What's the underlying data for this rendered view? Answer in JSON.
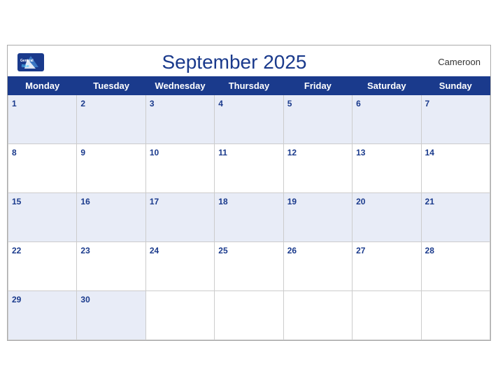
{
  "header": {
    "title": "September 2025",
    "country": "Cameroon",
    "logo_line1": "General",
    "logo_line2": "Blue"
  },
  "days": [
    "Monday",
    "Tuesday",
    "Wednesday",
    "Thursday",
    "Friday",
    "Saturday",
    "Sunday"
  ],
  "weeks": [
    [
      {
        "num": "1"
      },
      {
        "num": "2"
      },
      {
        "num": "3"
      },
      {
        "num": "4"
      },
      {
        "num": "5"
      },
      {
        "num": "6"
      },
      {
        "num": "7"
      }
    ],
    [
      {
        "num": "8"
      },
      {
        "num": "9"
      },
      {
        "num": "10"
      },
      {
        "num": "11"
      },
      {
        "num": "12"
      },
      {
        "num": "13"
      },
      {
        "num": "14"
      }
    ],
    [
      {
        "num": "15"
      },
      {
        "num": "16"
      },
      {
        "num": "17"
      },
      {
        "num": "18"
      },
      {
        "num": "19"
      },
      {
        "num": "20"
      },
      {
        "num": "21"
      }
    ],
    [
      {
        "num": "22"
      },
      {
        "num": "23"
      },
      {
        "num": "24"
      },
      {
        "num": "25"
      },
      {
        "num": "26"
      },
      {
        "num": "27"
      },
      {
        "num": "28"
      }
    ],
    [
      {
        "num": "29"
      },
      {
        "num": "30"
      },
      {
        "num": ""
      },
      {
        "num": ""
      },
      {
        "num": ""
      },
      {
        "num": ""
      },
      {
        "num": ""
      }
    ]
  ]
}
